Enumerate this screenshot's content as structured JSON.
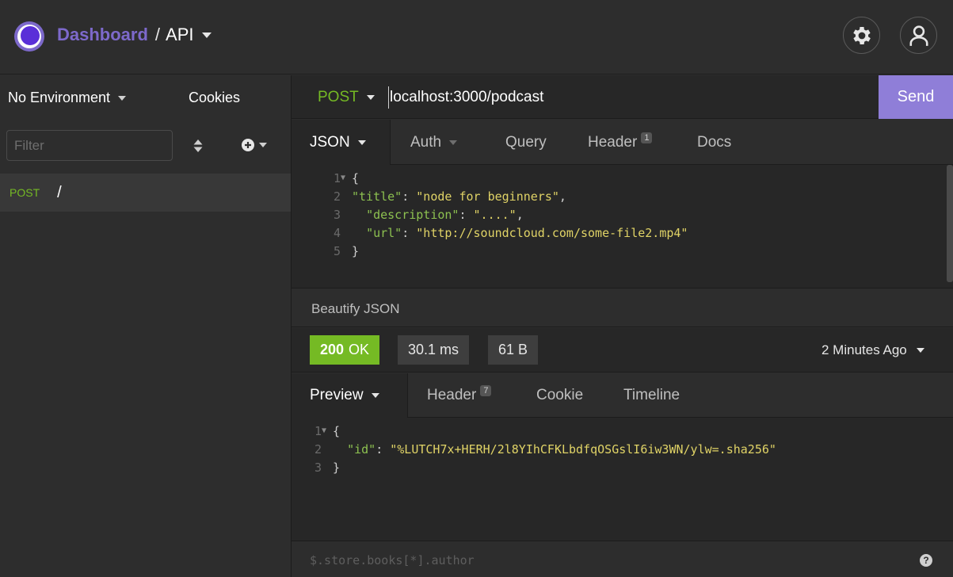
{
  "header": {
    "breadcrumb_root": "Dashboard",
    "breadcrumb_separator": "/",
    "breadcrumb_current": "API",
    "icons": [
      "logo-icon",
      "gear-icon",
      "user-icon"
    ]
  },
  "sidebar": {
    "environment": "No Environment",
    "cookies_label": "Cookies",
    "filter_placeholder": "Filter",
    "requests": [
      {
        "method": "POST",
        "name": "/"
      }
    ]
  },
  "request": {
    "method": "POST",
    "url": "localhost:3000/podcast",
    "send_label": "Send",
    "tabs": [
      {
        "label": "JSON",
        "active": true
      },
      {
        "label": "Auth"
      },
      {
        "label": "Query"
      },
      {
        "label": "Header",
        "badge": "1"
      },
      {
        "label": "Docs"
      }
    ],
    "body_lines": [
      {
        "n": "1",
        "text": "{"
      },
      {
        "n": "2",
        "key": "\"title\"",
        "value": "\"node for beginners\""
      },
      {
        "n": "3",
        "key": "\"description\"",
        "value": "\"....\""
      },
      {
        "n": "4",
        "key": "\"url\"",
        "value": "\"http://soundcloud.com/some-file2.mp4\""
      },
      {
        "n": "5",
        "text": "}"
      }
    ],
    "beautify_label": "Beautify JSON"
  },
  "response": {
    "status_code": "200",
    "status_text": "OK",
    "time": "30.1 ms",
    "size": "61 B",
    "history": "2 Minutes Ago",
    "tabs": [
      {
        "label": "Preview",
        "active": true
      },
      {
        "label": "Header",
        "badge": "7"
      },
      {
        "label": "Cookie"
      },
      {
        "label": "Timeline"
      }
    ],
    "body_lines": [
      {
        "n": "1",
        "text": "{"
      },
      {
        "n": "2",
        "key": "\"id\"",
        "value": "\"%LUTCH7x+HERH/2l8YIhCFKLbdfqOSGslI6iw3WN/ylw=.sha256\""
      },
      {
        "n": "3",
        "text": "}"
      }
    ],
    "filter_placeholder": "$.store.books[*].author"
  },
  "colors": {
    "accent": "#7d69cb",
    "send_button": "#8f7ed8",
    "success": "#75ba24",
    "background": "#2d2d2d"
  }
}
